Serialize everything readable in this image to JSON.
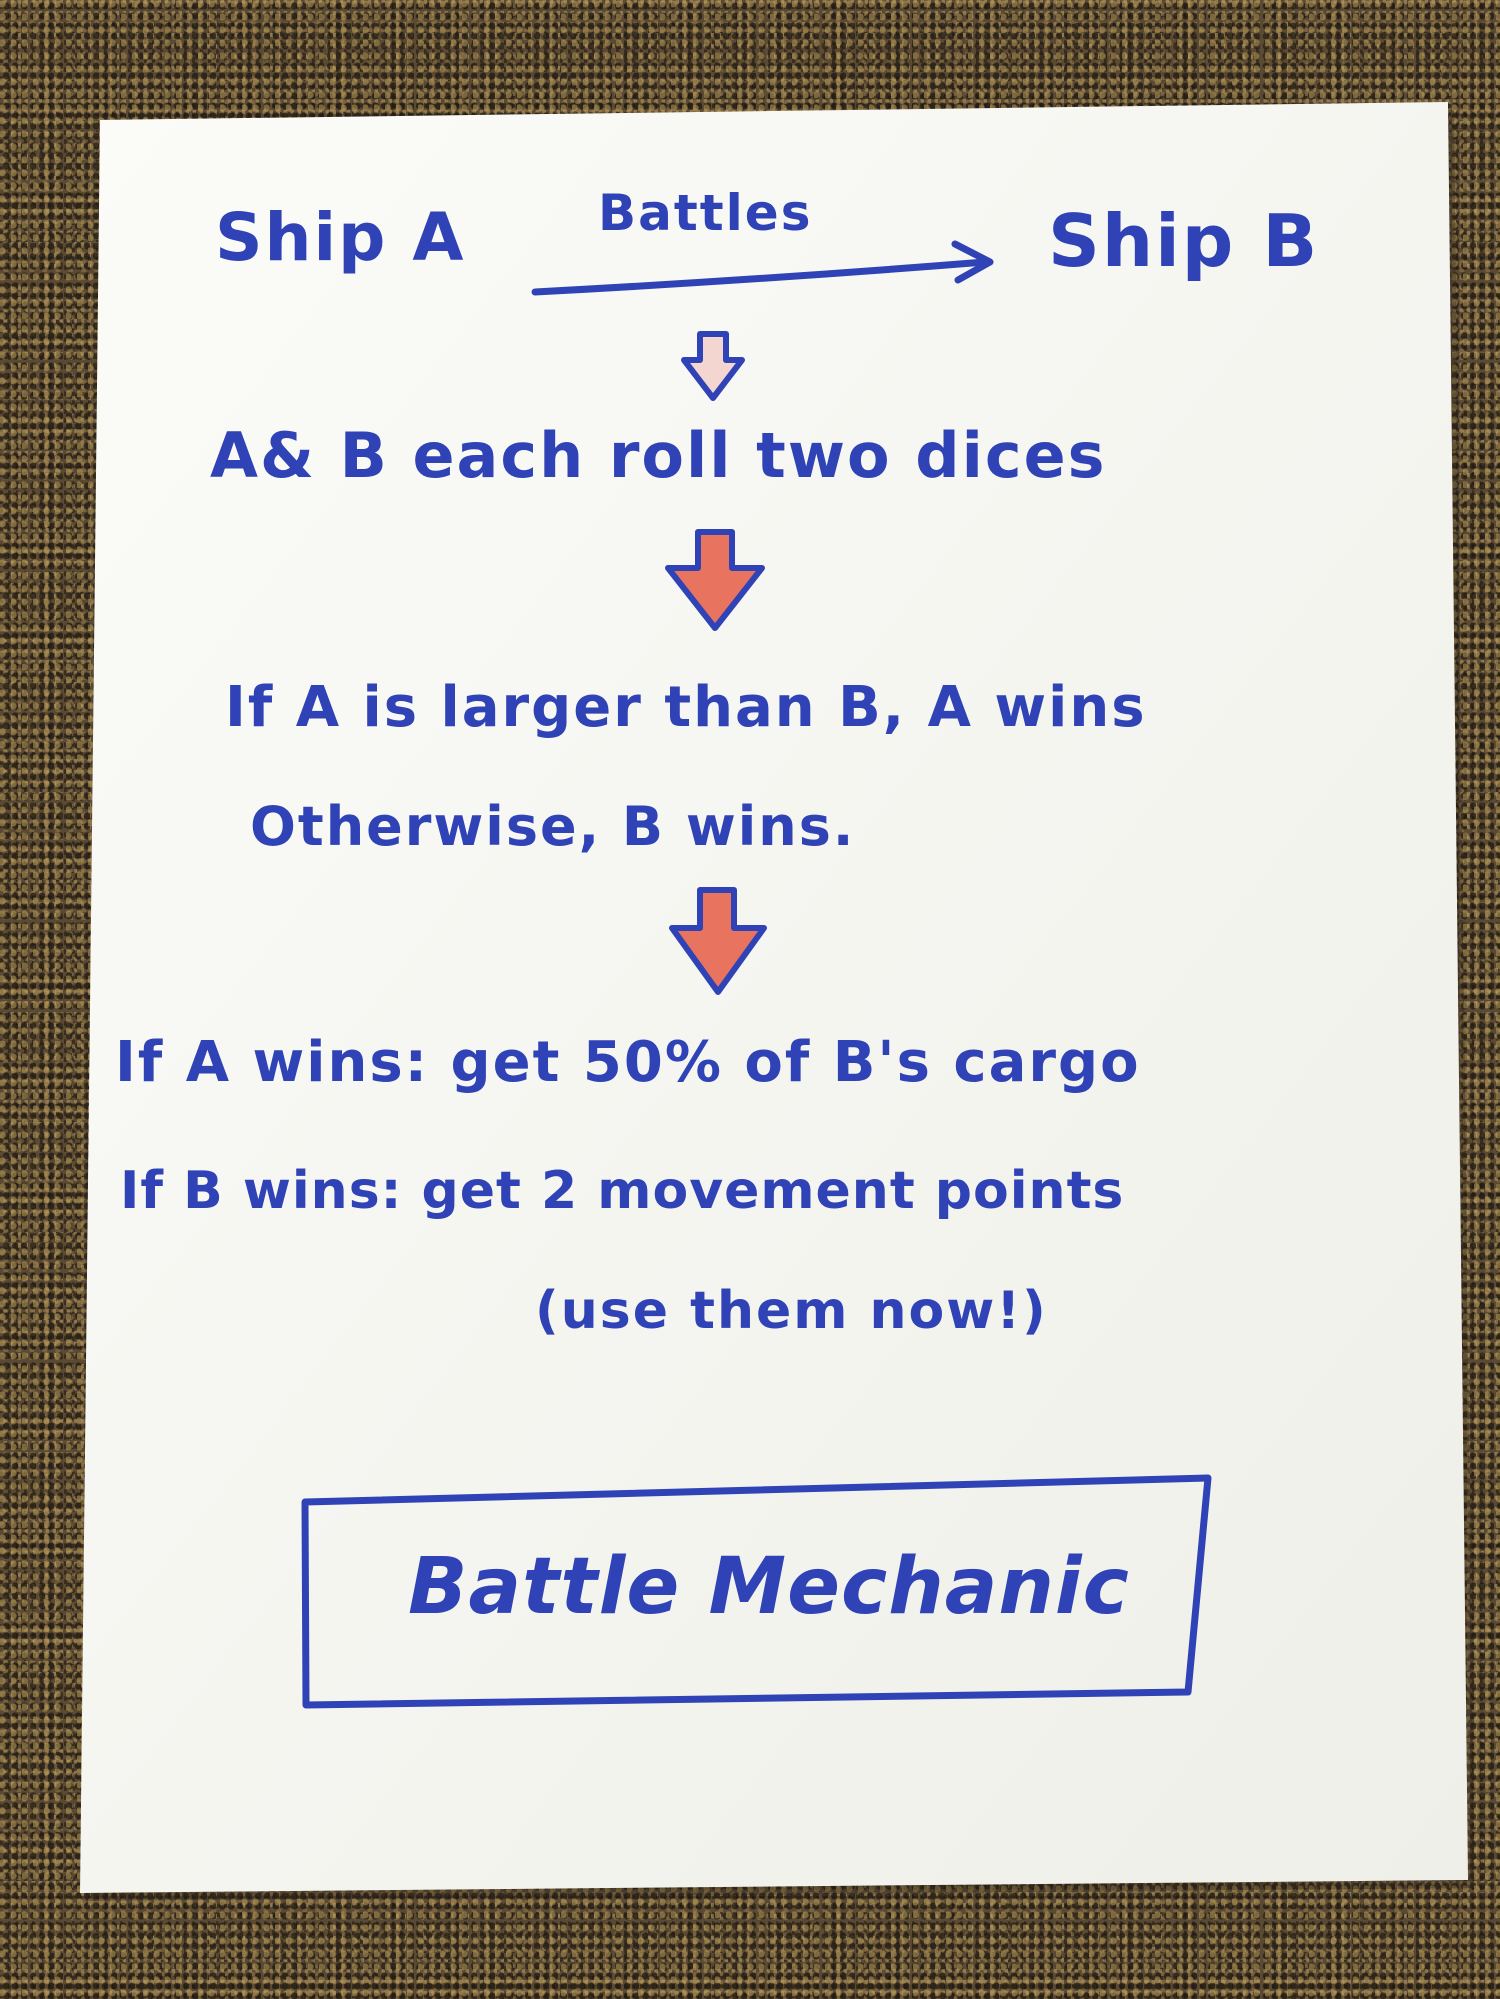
{
  "title": "Battle Mechanic",
  "nodes": {
    "ship_a": "Ship A",
    "ship_b": "Ship B",
    "edge_label": "Battles",
    "roll_step": "A& B each roll two dices",
    "compare_line1": "If A is larger than B, A wins",
    "compare_line2": "Otherwise, B wins.",
    "outcome_a": "If A wins: get 50% of B's cargo",
    "outcome_b": "If B wins: get 2 movement points",
    "outcome_b_note": "(use them now!)"
  },
  "colors": {
    "ink": "#2f43b6",
    "arrow_fill": "#e8735f",
    "paper": "#f7f7f3",
    "carpet": "#5b4a33"
  }
}
